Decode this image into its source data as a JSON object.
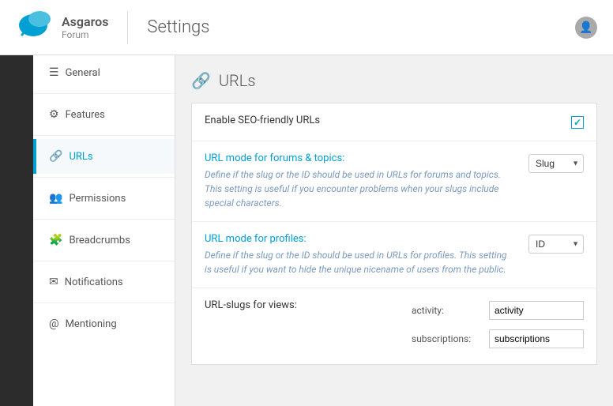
{
  "header": {
    "logo_name": "Asgaros",
    "logo_sub": "Forum",
    "title": "Settings"
  },
  "sidebar": {
    "items": [
      {
        "id": "general",
        "label": "General",
        "icon": "≡",
        "active": false
      },
      {
        "id": "features",
        "label": "Features",
        "icon": "⚙",
        "active": false
      },
      {
        "id": "urls",
        "label": "URLs",
        "icon": "🔗",
        "active": true
      },
      {
        "id": "permissions",
        "label": "Permissions",
        "icon": "👥",
        "active": false
      },
      {
        "id": "breadcrumbs",
        "label": "Breadcrumbs",
        "icon": "🧩",
        "active": false
      },
      {
        "id": "notifications",
        "label": "Notifications",
        "icon": "✉",
        "active": false
      },
      {
        "id": "mentioning",
        "label": "Mentioning",
        "icon": "@",
        "active": false
      }
    ]
  },
  "page": {
    "title": "URLs",
    "icon": "🔗"
  },
  "settings": {
    "seo_label": "Enable SEO-friendly URLs",
    "seo_checked": true,
    "forum_mode_label": "URL mode for forums & topics:",
    "forum_mode_desc": "Define if the slug or the ID should be used in URLs for forums and topics. This setting is useful if you encounter problems when your slugs include special characters.",
    "forum_mode_value": "Slug",
    "forum_mode_options": [
      "Slug",
      "ID"
    ],
    "profile_mode_label": "URL mode for profiles:",
    "profile_mode_desc": "Define if the slug or the ID should be used in URLs for profiles. This setting is useful if you want to hide the unique nicename of users from the public.",
    "profile_mode_value": "ID",
    "profile_mode_options": [
      "Slug",
      "ID"
    ],
    "url_slugs_label": "URL-slugs for views:",
    "slug_activity_label": "activity:",
    "slug_activity_value": "",
    "slug_subscriptions_label": "subscriptions:"
  }
}
